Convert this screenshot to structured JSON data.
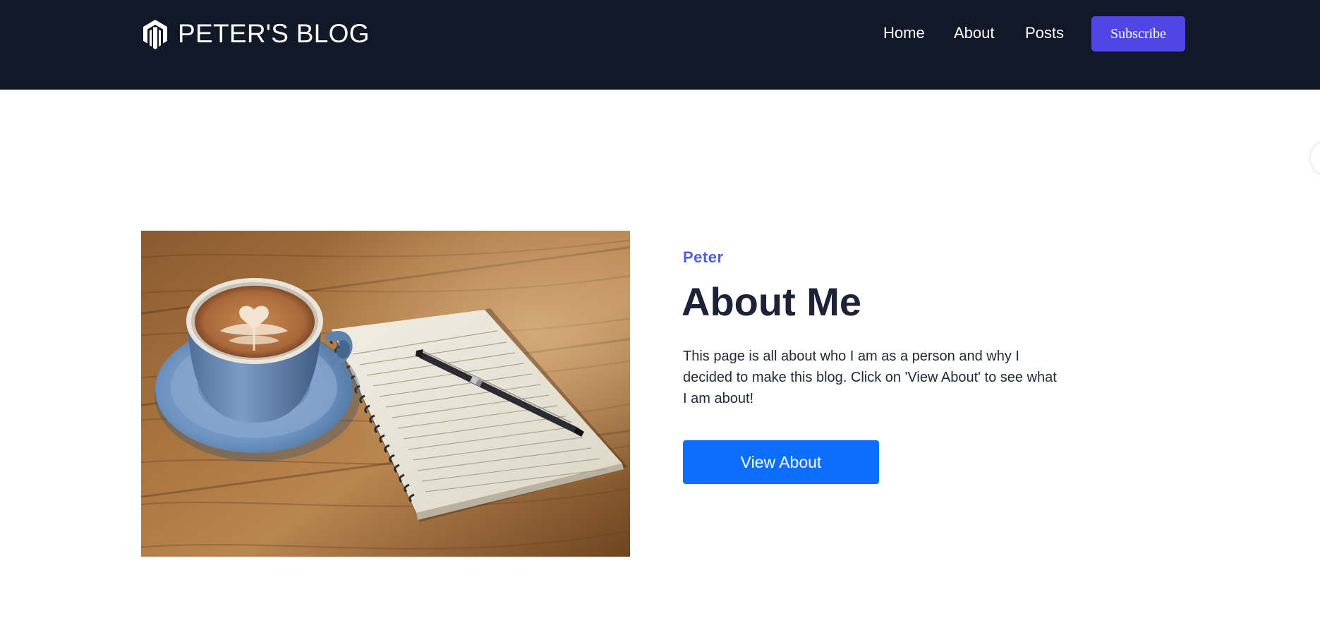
{
  "header": {
    "brand_name": "PETER'S BLOG",
    "logo_icon": "hexagon-m-logo-icon",
    "nav": [
      {
        "label": "Home"
      },
      {
        "label": "About"
      },
      {
        "label": "Posts"
      }
    ],
    "subscribe_label": "Subscribe",
    "background_color": "#111827",
    "subscribe_color": "#4f46e5"
  },
  "hero": {
    "image_subject": "coffee-cup-notebook-pen-image",
    "author": "Peter",
    "title": "About Me",
    "description": "This page is all about who I am as a person and why I decided to make this blog. Click on 'View About' to see what I am about!",
    "cta_label": "View About",
    "cta_color": "#0d6efd",
    "author_color": "#4f5fdc"
  }
}
